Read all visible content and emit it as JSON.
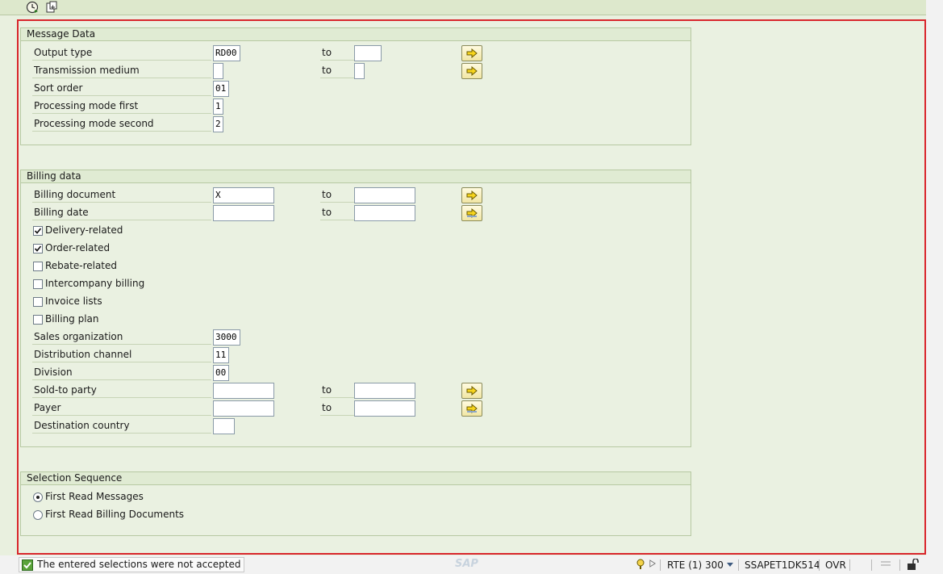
{
  "toolbar": {
    "execute_icon": "clock-execute-icon",
    "variant_icon": "get-variant-icon"
  },
  "message_data": {
    "title": "Message Data",
    "to_label": "to",
    "output_type": {
      "label": "Output type",
      "value": "RD00",
      "to_value": ""
    },
    "transmission_medium": {
      "label": "Transmission medium",
      "value": "",
      "to_value": ""
    },
    "sort_order": {
      "label": "Sort order",
      "value": "01"
    },
    "processing_mode_first": {
      "label": "Processing mode first",
      "value": "1"
    },
    "processing_mode_second": {
      "label": "Processing mode second",
      "value": "2"
    }
  },
  "billing_data": {
    "title": "Billing data",
    "to_label": "to",
    "billing_document": {
      "label": "Billing document",
      "value": "X",
      "to_value": ""
    },
    "billing_date": {
      "label": "Billing date",
      "value": "",
      "to_value": ""
    },
    "checkboxes": [
      {
        "label": "Delivery-related",
        "checked": true
      },
      {
        "label": "Order-related",
        "checked": true
      },
      {
        "label": "Rebate-related",
        "checked": false
      },
      {
        "label": "Intercompany billing",
        "checked": false
      },
      {
        "label": "Invoice lists",
        "checked": false
      },
      {
        "label": "Billing plan",
        "checked": false
      }
    ],
    "sales_organization": {
      "label": "Sales organization",
      "value": "3000"
    },
    "distribution_channel": {
      "label": "Distribution channel",
      "value": "11"
    },
    "division": {
      "label": "Division",
      "value": "00"
    },
    "sold_to_party": {
      "label": "Sold-to party",
      "value": "",
      "to_value": ""
    },
    "payer": {
      "label": "Payer",
      "value": "",
      "to_value": ""
    },
    "destination_country": {
      "label": "Destination country",
      "value": ""
    }
  },
  "selection_sequence": {
    "title": "Selection Sequence",
    "options": [
      {
        "label": "First Read Messages",
        "selected": true
      },
      {
        "label": "First Read Billing Documents",
        "selected": false
      }
    ]
  },
  "statusbar": {
    "message": "The entered selections were not accepted",
    "logo": "SAP",
    "system": "RTE (1) 300",
    "server": "SSAPET1DK514",
    "mode": "OVR"
  },
  "colors": {
    "frame_highlight": "#d9262c",
    "background": "#eaf1e1",
    "arrow_button": "#f1e6a4"
  }
}
